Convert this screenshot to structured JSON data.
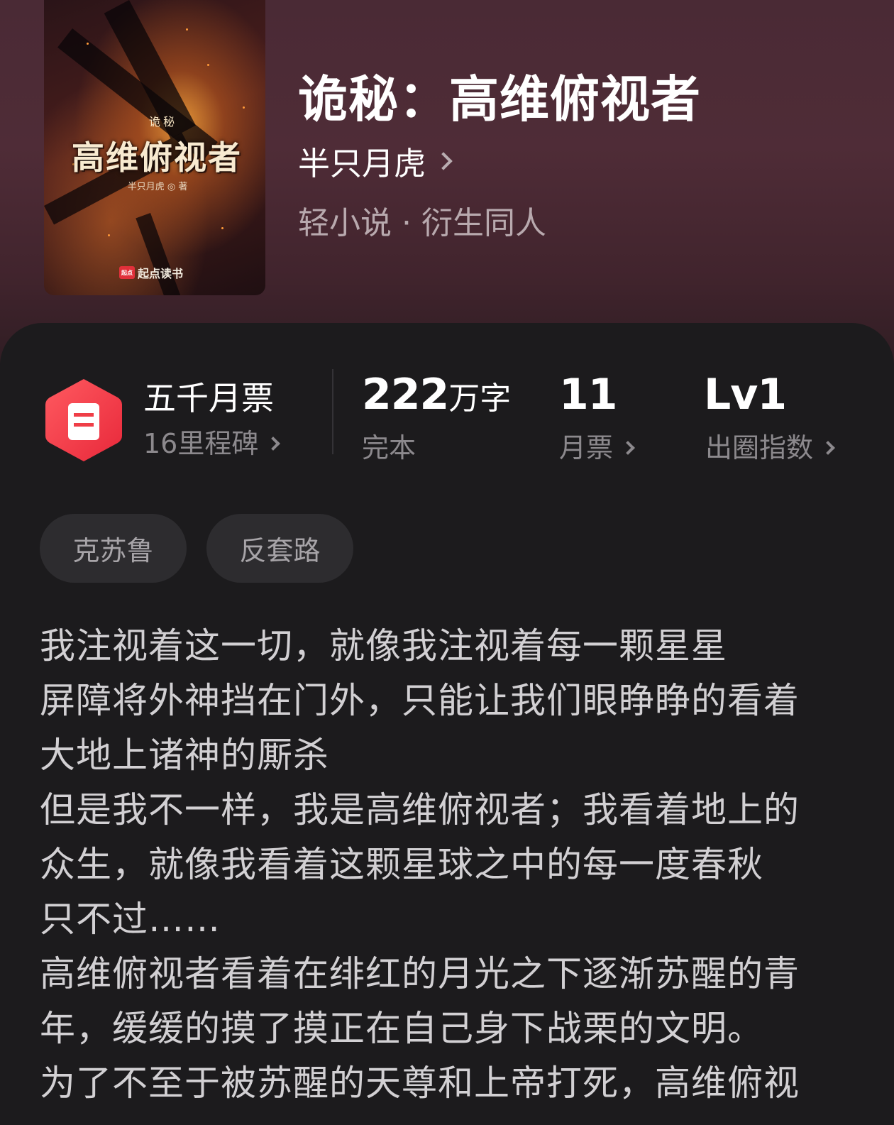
{
  "book": {
    "title": "诡秘：高维俯视者",
    "author": "半只月虎",
    "genre": "轻小说 · 衍生同人"
  },
  "cover": {
    "small_title": "诡秘",
    "title": "高维俯视者",
    "author_line": "半只月虎 ◎ 著",
    "brand_mark": "起点",
    "brand": "起点读书"
  },
  "stats": {
    "monthly_ticket": {
      "title": "五千月票",
      "sub": "16里程碑"
    },
    "word_count": {
      "number": "222",
      "unit": "万字",
      "status": "完本"
    },
    "votes": {
      "number": "11",
      "label": "月票"
    },
    "circle_index": {
      "level": "Lv1",
      "label": "出圈指数"
    }
  },
  "tags": [
    "克苏鲁",
    "反套路"
  ],
  "synopsis_lines": [
    "我注视着这一切，就像我注视着每一颗星星",
    "屏障将外神挡在门外，只能让我们眼睁睁的看着",
    "大地上诸神的厮杀",
    "但是我不一样，我是高维俯视者；我看着地上的",
    "众生，就像我看着这颗星球之中的每一度春秋",
    "只不过……",
    "高维俯视者看着在绯红的月光之下逐渐苏醒的青",
    "年，缓缓的摸了摸正在自己身下战栗的文明。",
    "为了不至于被苏醒的天尊和上帝打死，高维俯视"
  ],
  "colors": {
    "header_bg": "#4a2a35",
    "card_bg": "#1c1b1d",
    "badge_red": "#ef3e47",
    "muted_text": "#8c898d"
  },
  "icons": {
    "badge": "ticket-hexagon-icon",
    "chevron": "chevron-right-icon"
  }
}
